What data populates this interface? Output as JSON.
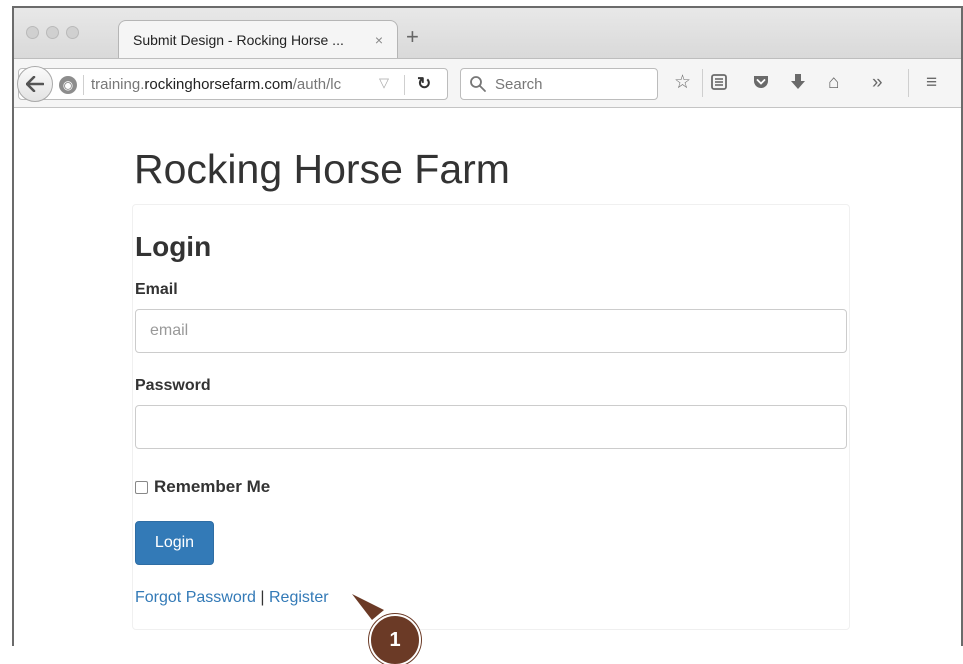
{
  "browser": {
    "tab_title": "Submit Design - Rocking Horse ...",
    "tab_close": "×",
    "new_tab": "+",
    "url_prefix": "training.",
    "url_domain": "rockinghorsefarm.com",
    "url_path": "/auth/lc",
    "search_placeholder": "Search",
    "icons": [
      "back-arrow-icon",
      "globe-icon",
      "dropdown-icon",
      "reload-icon",
      "search-icon",
      "star-icon",
      "reading-list-icon",
      "pocket-icon",
      "download-icon",
      "home-icon",
      "overflow-icon",
      "menu-icon"
    ]
  },
  "page": {
    "site_title": "Rocking Horse Farm",
    "login_heading": "Login",
    "email_label": "Email",
    "email_placeholder": "email",
    "email_value": "",
    "password_label": "Password",
    "password_value": "",
    "remember_label": "Remember Me",
    "remember_checked": false,
    "login_button": "Login",
    "forgot_link": "Forgot Password",
    "link_separator": "|",
    "register_link": "Register"
  },
  "callout": {
    "number": "1"
  },
  "colors": {
    "primary": "#337ab7",
    "callout": "#6b3a26",
    "text": "#333333"
  }
}
